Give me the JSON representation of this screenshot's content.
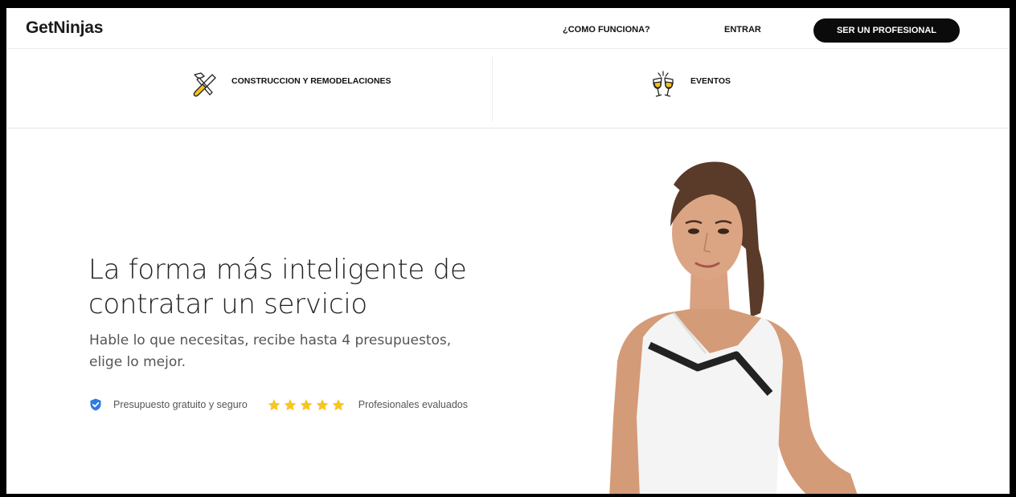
{
  "brand": {
    "logo": "GetNinjas"
  },
  "nav": {
    "how_it_works": "¿COMO FUNCIONA?",
    "login": "ENTRAR",
    "become_pro": "SER UN PROFESIONAL"
  },
  "categories": [
    {
      "label": "CONSTRUCCION Y REMODELACIONES",
      "icon": "tools-icon"
    },
    {
      "label": "EVENTOS",
      "icon": "champagne-glasses-icon"
    }
  ],
  "hero": {
    "title_line1": "La forma más inteligente de",
    "title_line2": "contratar un servicio",
    "subtitle_line1": "Hable lo que necesitas, recibe hasta 4 presupuestos,",
    "subtitle_line2": "elige lo mejor.",
    "trust_free": "Presupuesto gratuito y seguro",
    "trust_rated": "Profesionales evaluados",
    "stars": 5
  },
  "colors": {
    "accent_button": "#0b0b0b",
    "shield": "#2f7be0",
    "star": "#f6c623",
    "icon_yellow": "#f2c21b"
  }
}
